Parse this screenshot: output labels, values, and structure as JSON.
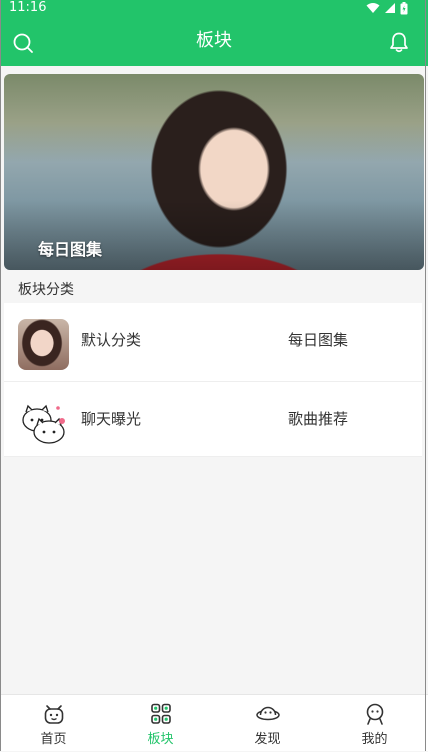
{
  "status": {
    "time": "11:16"
  },
  "header": {
    "title": "板块",
    "accent": "#22c46a"
  },
  "banner": {
    "title": "每日图集"
  },
  "section": {
    "label": "板块分类"
  },
  "categories": [
    {
      "name": "默认分类",
      "extra": "每日图集"
    },
    {
      "name": "聊天曝光",
      "extra": "歌曲推荐"
    }
  ],
  "tabs": [
    {
      "label": "首页",
      "icon": "home-icon",
      "active": false
    },
    {
      "label": "板块",
      "icon": "grid-icon",
      "active": true
    },
    {
      "label": "发现",
      "icon": "planet-icon",
      "active": false
    },
    {
      "label": "我的",
      "icon": "profile-icon",
      "active": false
    }
  ]
}
